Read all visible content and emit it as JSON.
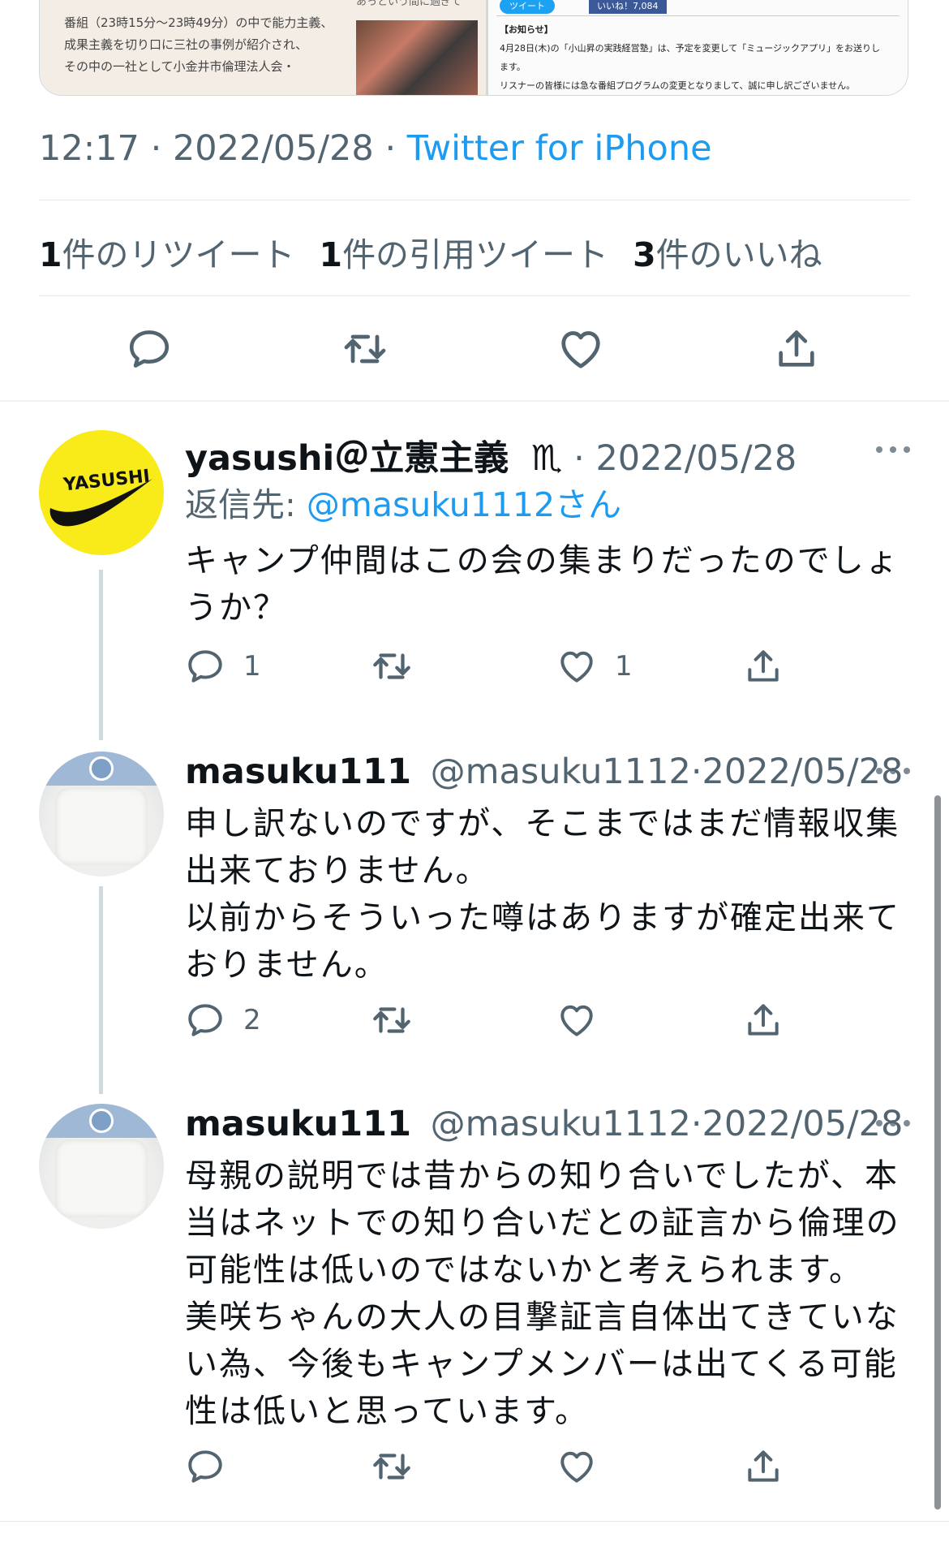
{
  "media": {
    "left_lines": [
      "番組（23時15分〜23時49分）の中で能力主義、",
      "成果主義を切り口に三社の事例が紹介され、",
      "その中の一社として小金井市倫理法人会・"
    ],
    "photo_caption": "あっという間に過ぎて",
    "tweet_button": "ツイート",
    "like_button": "いいね！7,084",
    "notice_title": "【お知らせ】",
    "notice_lines": [
      "4月28日(木)の「小山昇の実践経営塾」は、予定を変更して「ミュージックアプリ」をお送りし",
      "ます。",
      "リスナーの皆様には急な番組プログラムの変更となりまして、誠に申し訳ございません。"
    ]
  },
  "tweet": {
    "time": "12:17",
    "date": "2022/05/28",
    "source": "Twitter for iPhone"
  },
  "counts": [
    {
      "num": "1",
      "label": "件のリツイート"
    },
    {
      "num": "1",
      "label": "件の引用ツイート"
    },
    {
      "num": "3",
      "label": "件のいいね"
    }
  ],
  "icons": {
    "reply": "reply-icon",
    "retweet": "retweet-icon",
    "like": "heart-icon",
    "share": "share-icon",
    "more": "more-icon"
  },
  "colors": {
    "link": "#1d9bf0",
    "secondary": "#536471",
    "text": "#0f1419"
  },
  "replies": [
    {
      "name": "yasushi＠立憲主義",
      "handle": "",
      "emoji": "♏",
      "date": "2022/05/28",
      "reply_to_prefix": "返信先:",
      "reply_to_handle": "@masuku1112",
      "reply_to_suffix": "さん",
      "text": "キャンプ仲間はこの会の集まりだったのでしょうか？",
      "avatar_text": "YASUSHI",
      "reply_count": "1",
      "retweet_count": "",
      "like_count": "1"
    },
    {
      "name": "masuku111",
      "handle": "@masuku1112",
      "date": "2022/05/28",
      "text": "申し訳ないのですが、そこまではまだ情報収集出来ておりません。\n以前からそういった噂はありますが確定出来ておりません。",
      "reply_count": "2",
      "retweet_count": "",
      "like_count": ""
    },
    {
      "name": "masuku111",
      "handle": "@masuku1112",
      "date": "2022/05/28",
      "text": "母親の説明では昔からの知り合いでしたが、本当はネットでの知り合いだとの証言から倫理の可能性は低いのではないかと考えられます。\n美咲ちゃんの大人の目撃証言自体出てきていない為、今後もキャンプメンバーは出てくる可能性は低いと思っています。",
      "reply_count": "",
      "retweet_count": "",
      "like_count": ""
    }
  ]
}
